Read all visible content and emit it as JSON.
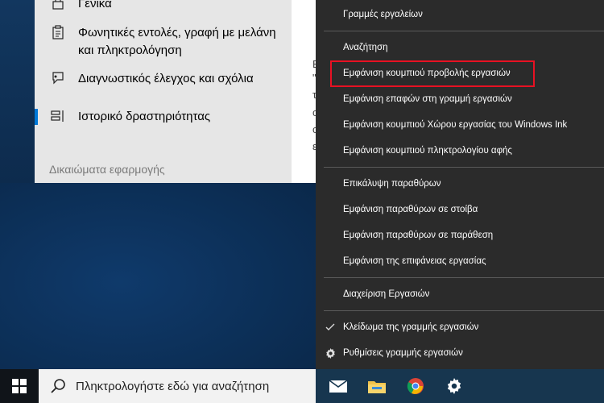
{
  "settings": {
    "nav_items": [
      {
        "label": "Γενικά",
        "icon": "lock-icon"
      },
      {
        "label": "Φωνητικές εντολές, γραφή με μελάνη και πληκτρολόγηση",
        "icon": "clipboard-icon"
      },
      {
        "label": "Διαγνωστικός έλεγχος και σχόλια",
        "icon": "feedback-icon"
      },
      {
        "label": "Ιστορικό δραστηριότητας",
        "icon": "timeline-icon"
      }
    ],
    "section_header": "Δικαιώματα εφαρμογής",
    "content_fragments": [
      "Ε",
      "\"",
      "τ",
      "c",
      "c",
      "ε"
    ]
  },
  "context_menu": {
    "items": [
      {
        "label": "Γραμμές εργαλείων"
      },
      {
        "label": "Αναζήτηση"
      },
      {
        "label": "Εμφάνιση κουμπιού προβολής εργασιών",
        "highlighted": true
      },
      {
        "label": "Εμφάνιση επαφών στη γραμμή εργασιών"
      },
      {
        "label": "Εμφάνιση κουμπιού Χώρου εργασίας του Windows Ink"
      },
      {
        "label": "Εμφάνιση κουμπιού πληκτρολογίου αφής"
      },
      {
        "label": "Επικάλυψη παραθύρων"
      },
      {
        "label": "Εμφάνιση παραθύρων σε στοίβα"
      },
      {
        "label": "Εμφάνιση παραθύρων σε παράθεση"
      },
      {
        "label": "Εμφάνιση της επιφάνειας εργασίας"
      },
      {
        "label": "Διαχείριση Εργασιών"
      },
      {
        "label": "Κλείδωμα της γραμμής εργασιών",
        "icon": "checkmark-icon",
        "checked": true
      },
      {
        "label": "Ρυθμίσεις γραμμής εργασιών",
        "icon": "gear-icon"
      }
    ],
    "highlight_color": "#e81123"
  },
  "taskbar": {
    "search_placeholder": "Πληκτρολογήστε εδώ για αναζήτηση",
    "pinned_icons": [
      "mail-icon",
      "file-explorer-icon",
      "chrome-icon",
      "settings-gear-icon"
    ]
  }
}
